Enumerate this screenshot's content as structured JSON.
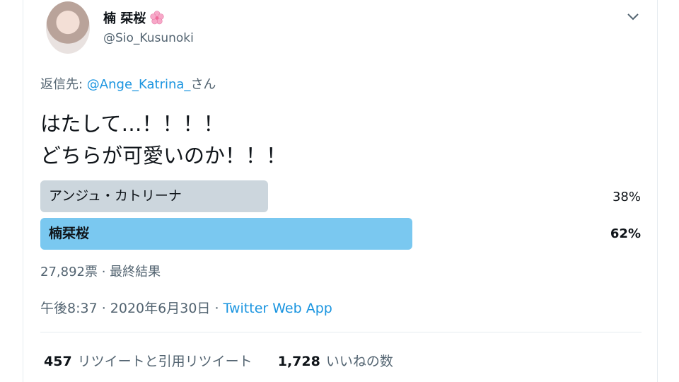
{
  "header": {
    "display_name": "楠 栞桜",
    "name_emoji": "cherry-blossom-icon",
    "handle": "@Sio_Kusunoki",
    "menu_icon": "chevron-down-icon"
  },
  "reply": {
    "prefix": "返信先: ",
    "mention": "@Ange_Katrina_",
    "suffix": "さん"
  },
  "tweet": {
    "lines": [
      "はたして…！！！！",
      "どちらが可愛いのか！！！"
    ]
  },
  "poll": {
    "options": [
      {
        "label": "アンジュ・カトリーナ",
        "percent_text": "38%",
        "percent": 38,
        "winner": false
      },
      {
        "label": "楠栞桜",
        "percent_text": "62%",
        "percent": 62,
        "winner": true
      }
    ],
    "votes": "27,892票",
    "separator": " · ",
    "status": "最終結果"
  },
  "meta": {
    "time": "午後8:37 · 2020年6月30日 · ",
    "source": "Twitter Web App"
  },
  "stats": {
    "retweets_count": "457",
    "retweets_label": "リツイートと引用リツイート",
    "likes_count": "1,728",
    "likes_label": "いいねの数"
  },
  "colors": {
    "link": "#1b95e0",
    "poll_winner": "#7ac8f0",
    "poll_other": "#ccd6dd",
    "secondary_text": "#536471"
  }
}
